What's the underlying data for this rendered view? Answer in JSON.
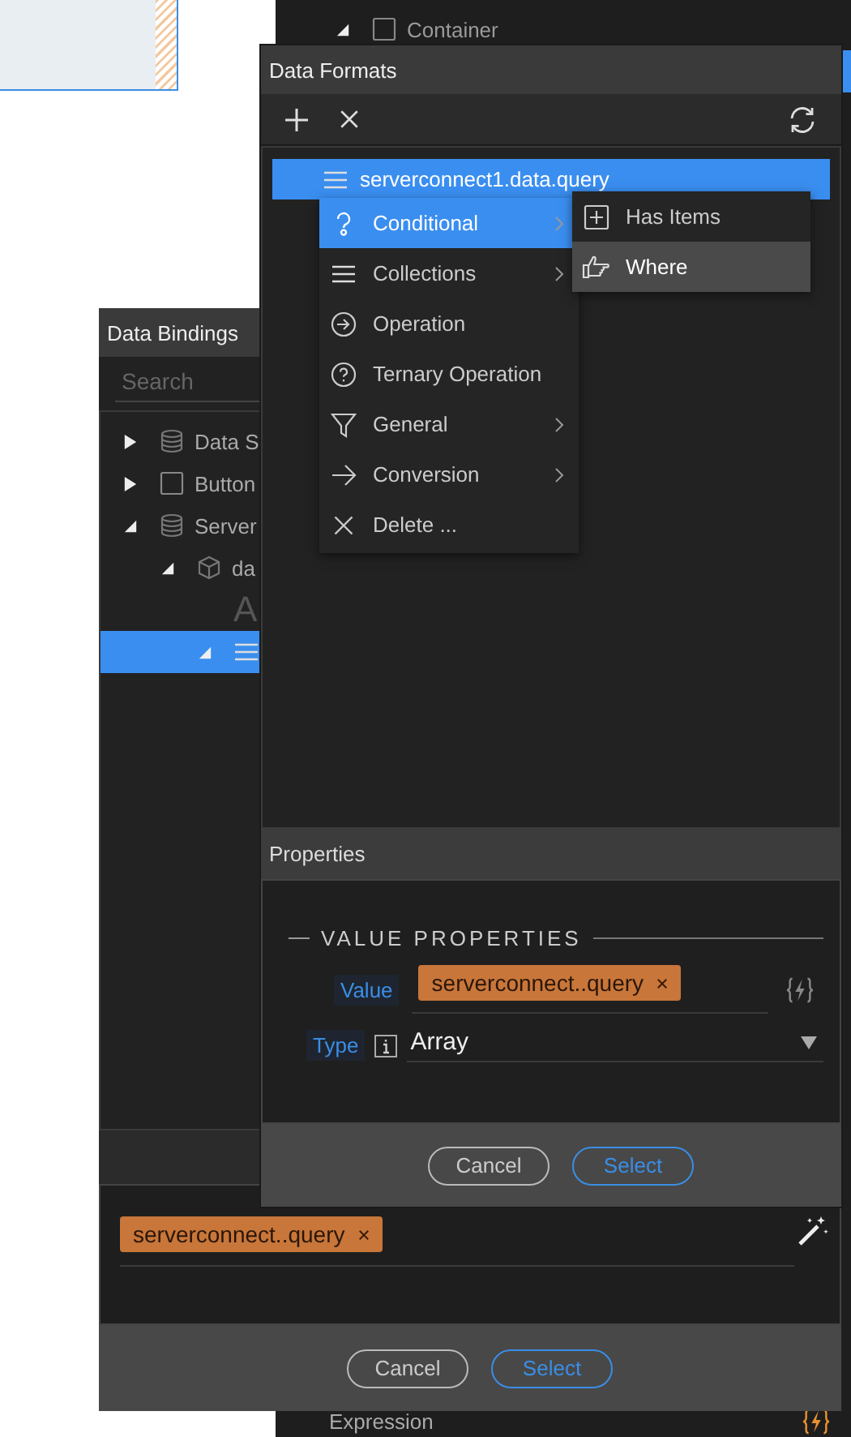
{
  "back_panel": {
    "tree": [
      {
        "label": "Container",
        "kind": "square",
        "expanded": true,
        "selected": false,
        "children": [
          {
            "selected": true
          }
        ]
      }
    ],
    "expression_label": "Expression"
  },
  "data_bindings": {
    "title": "Data Bindings",
    "search": {
      "placeholder": "Search"
    },
    "tree": [
      {
        "label": "Data S",
        "kind": "database",
        "expanded": false,
        "selected": false
      },
      {
        "label": "Button",
        "kind": "square",
        "expanded": false,
        "selected": false
      },
      {
        "label": "Server",
        "kind": "database",
        "expanded": true,
        "selected": false,
        "children": [
          {
            "label": "da",
            "kind": "cube",
            "expanded": true,
            "selected": false,
            "children": [
              {
                "label": "A",
                "kind": "letter",
                "selected": false
              },
              {
                "kind": "list",
                "expanded": true,
                "selected": true
              }
            ]
          }
        ]
      }
    ],
    "value_tag": "serverconnect..query",
    "buttons": [
      {
        "label": "Cancel",
        "kind": "secondary"
      },
      {
        "label": "Select",
        "kind": "primary"
      }
    ]
  },
  "data_formats": {
    "title": "Data Formats",
    "tree": [
      {
        "label": "serverconnect1.data.query",
        "kind": "list",
        "selected": true
      }
    ],
    "properties": {
      "title": "Properties",
      "heading": "VALUE PROPERTIES",
      "value_label": "Value",
      "value_tag": "serverconnect..query",
      "type_label": "Type",
      "type_value": "Array"
    },
    "buttons": [
      {
        "label": "Cancel",
        "kind": "secondary"
      },
      {
        "label": "Select",
        "kind": "primary"
      }
    ]
  },
  "context_menu": {
    "items": [
      {
        "label": "Conditional",
        "kind": "hook-question",
        "has_submenu": true,
        "selected": true
      },
      {
        "label": "Collections",
        "kind": "list",
        "has_submenu": true,
        "selected": false
      },
      {
        "label": "Operation",
        "kind": "circle-arrow",
        "has_submenu": false,
        "selected": false
      },
      {
        "label": "Ternary Operation",
        "kind": "circle-question",
        "has_submenu": false,
        "selected": false
      },
      {
        "label": "General",
        "kind": "funnel",
        "has_submenu": true,
        "selected": false
      },
      {
        "label": "Conversion",
        "kind": "arrow",
        "has_submenu": true,
        "selected": false
      },
      {
        "label": "Delete ...",
        "kind": "cross",
        "has_submenu": false,
        "selected": false
      }
    ]
  },
  "submenu": {
    "items": [
      {
        "label": "Has Items",
        "kind": "plus-box",
        "selected": false
      },
      {
        "label": "Where",
        "kind": "hand",
        "selected": true
      }
    ]
  }
}
